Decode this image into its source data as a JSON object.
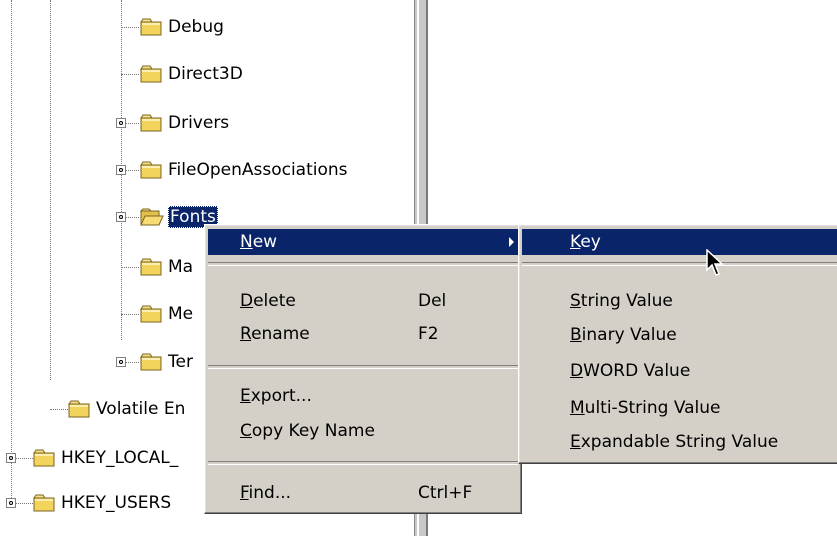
{
  "tree": {
    "nodes": [
      {
        "label": "Debug"
      },
      {
        "label": "Direct3D"
      },
      {
        "label": "Drivers"
      },
      {
        "label": "FileOpenAssociations"
      },
      {
        "label": "Fonts"
      },
      {
        "label": "Ma"
      },
      {
        "label": "Me"
      },
      {
        "label": "Ter"
      },
      {
        "label": "Volatile En"
      },
      {
        "label": "HKEY_LOCAL_"
      },
      {
        "label": "HKEY_USERS"
      }
    ]
  },
  "context_menu": {
    "new": {
      "prefix": "",
      "mnemonic": "N",
      "rest": "ew"
    },
    "delete": {
      "prefix": "",
      "mnemonic": "D",
      "rest": "elete",
      "shortcut": "Del"
    },
    "rename": {
      "prefix": "",
      "mnemonic": "R",
      "rest": "ename",
      "shortcut": "F2"
    },
    "export": {
      "prefix": "",
      "mnemonic": "E",
      "rest": "xport..."
    },
    "copy_key_name": {
      "prefix": "",
      "mnemonic": "C",
      "rest": "opy Key Name"
    },
    "find": {
      "prefix": "",
      "mnemonic": "F",
      "rest": "ind...",
      "shortcut": "Ctrl+F"
    }
  },
  "submenu": {
    "key": {
      "prefix": "",
      "mnemonic": "K",
      "rest": "ey"
    },
    "string_value": {
      "prefix": "",
      "mnemonic": "S",
      "rest": "tring Value"
    },
    "binary_value": {
      "prefix": "",
      "mnemonic": "B",
      "rest": "inary Value"
    },
    "dword_value": {
      "prefix": "",
      "mnemonic": "D",
      "rest": "WORD Value"
    },
    "multi_string_value": {
      "prefix": "",
      "mnemonic": "M",
      "rest": "ulti-String Value"
    },
    "expandable_string_value": {
      "prefix": "",
      "mnemonic": "E",
      "rest": "xpandable String Value"
    }
  },
  "icons": {
    "folder": "folder-icon",
    "folder_open": "folder-open-icon",
    "expander": "expand-collapse-icon",
    "submenu_arrow": "chevron-right-icon",
    "pointer": "mouse-pointer-icon"
  },
  "colors": {
    "menu_bg": "#d4d0c8",
    "highlight": "#0a246a",
    "folder": "#f2d35c"
  }
}
